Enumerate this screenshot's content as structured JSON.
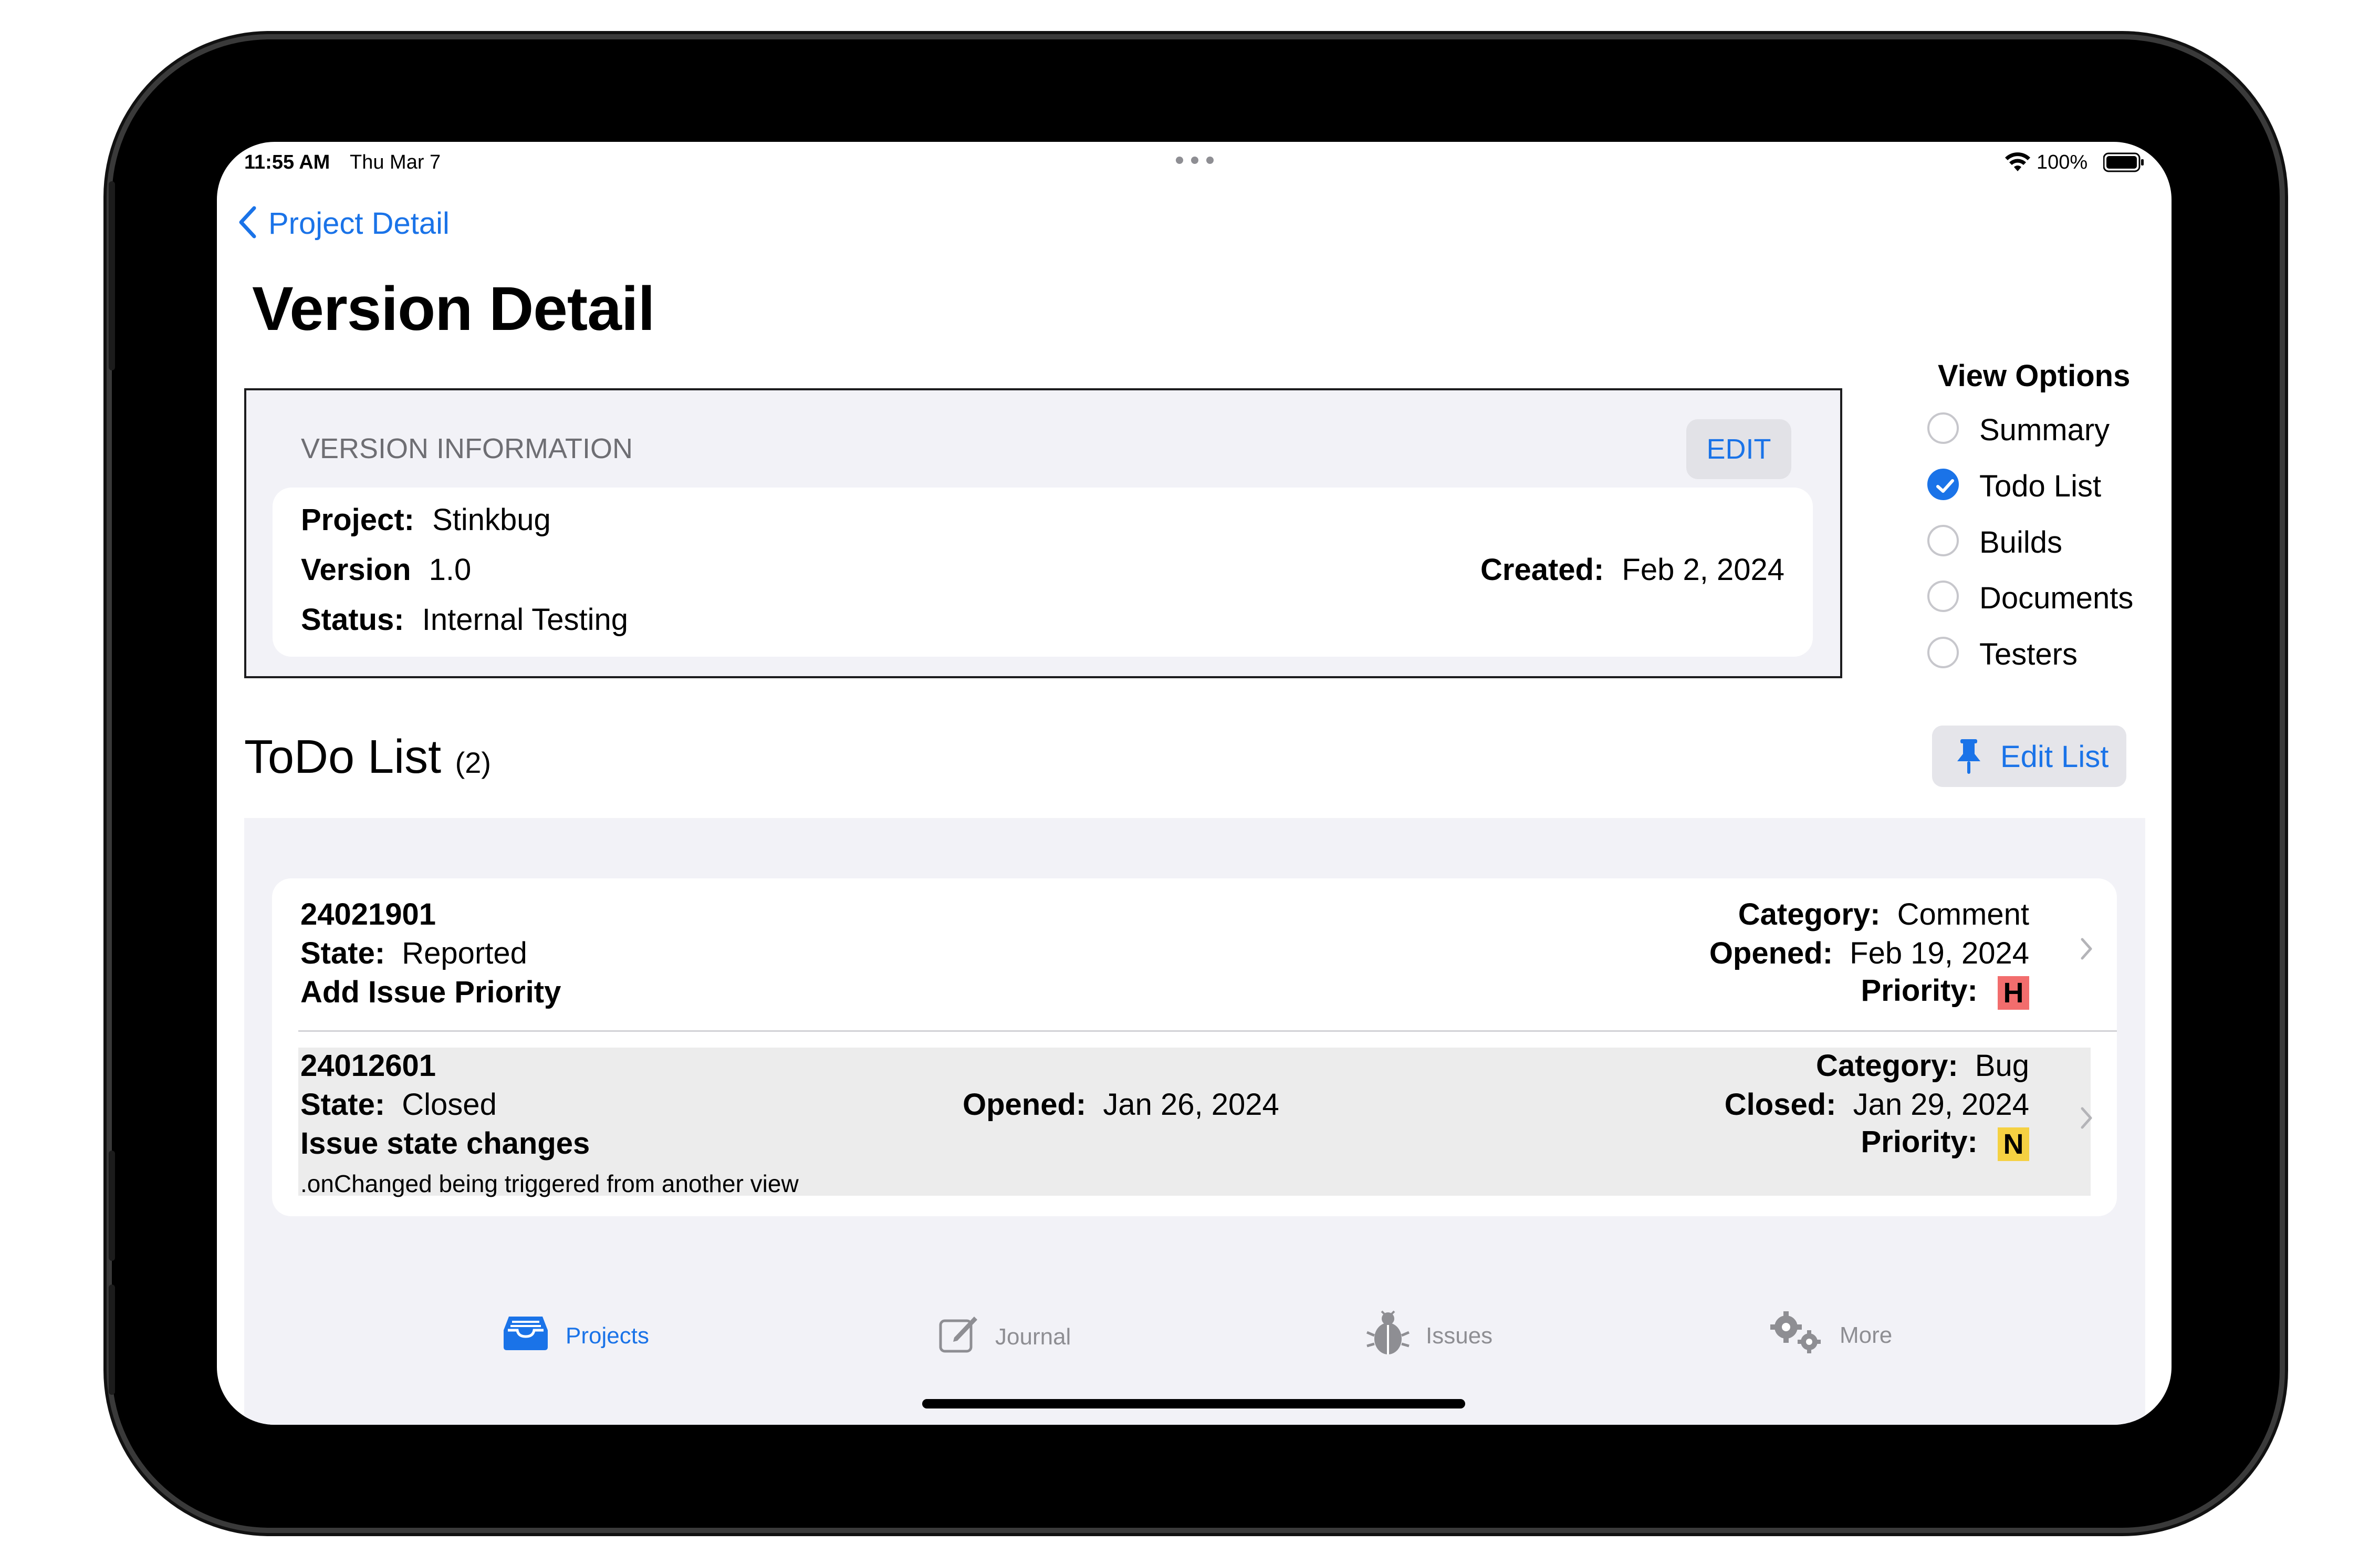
{
  "status_bar": {
    "time": "11:55 AM",
    "date": "Thu Mar 7",
    "battery": "100%"
  },
  "nav": {
    "back_label": "Project Detail"
  },
  "page": {
    "title": "Version Detail"
  },
  "version_info": {
    "header": "VERSION INFORMATION",
    "edit_label": "EDIT",
    "project_label": "Project:",
    "project_value": "Stinkbug",
    "version_label": "Version",
    "version_value": "1.0",
    "status_label": "Status:",
    "status_value": "Internal Testing",
    "created_label": "Created:",
    "created_value": "Feb 2, 2024"
  },
  "view_options": {
    "title": "View Options",
    "items": [
      {
        "label": "Summary",
        "checked": false
      },
      {
        "label": "Todo List",
        "checked": true
      },
      {
        "label": "Builds",
        "checked": false
      },
      {
        "label": "Documents",
        "checked": false
      },
      {
        "label": "Testers",
        "checked": false
      }
    ]
  },
  "todo": {
    "title": "ToDo List",
    "count": "(2)",
    "edit_list_label": "Edit List",
    "items": [
      {
        "id": "24021901",
        "state_label": "State:",
        "state": "Reported",
        "title": "Add Issue Priority",
        "category_label": "Category:",
        "category": "Comment",
        "opened_label": "Opened:",
        "opened": "Feb 19, 2024",
        "priority_label": "Priority:",
        "priority": "H",
        "priority_color": "#f26d6d"
      },
      {
        "id": "24012601",
        "state_label": "State:",
        "state": "Closed",
        "title": "Issue state changes",
        "note": ".onChanged being triggered from another view",
        "opened_label": "Opened:",
        "opened": "Jan 26, 2024",
        "category_label": "Category:",
        "category": "Bug",
        "closed_label": "Closed:",
        "closed": "Jan 29, 2024",
        "priority_label": "Priority:",
        "priority": "N",
        "priority_color": "#f5d142"
      }
    ]
  },
  "tabs": [
    {
      "label": "Projects",
      "icon": "tray-icon",
      "active": true
    },
    {
      "label": "Journal",
      "icon": "compose-icon",
      "active": false
    },
    {
      "label": "Issues",
      "icon": "ladybug-icon",
      "active": false
    },
    {
      "label": "More",
      "icon": "gears-icon",
      "active": false
    }
  ],
  "colors": {
    "accent": "#1a73e8",
    "background": "#f2f2f7"
  }
}
